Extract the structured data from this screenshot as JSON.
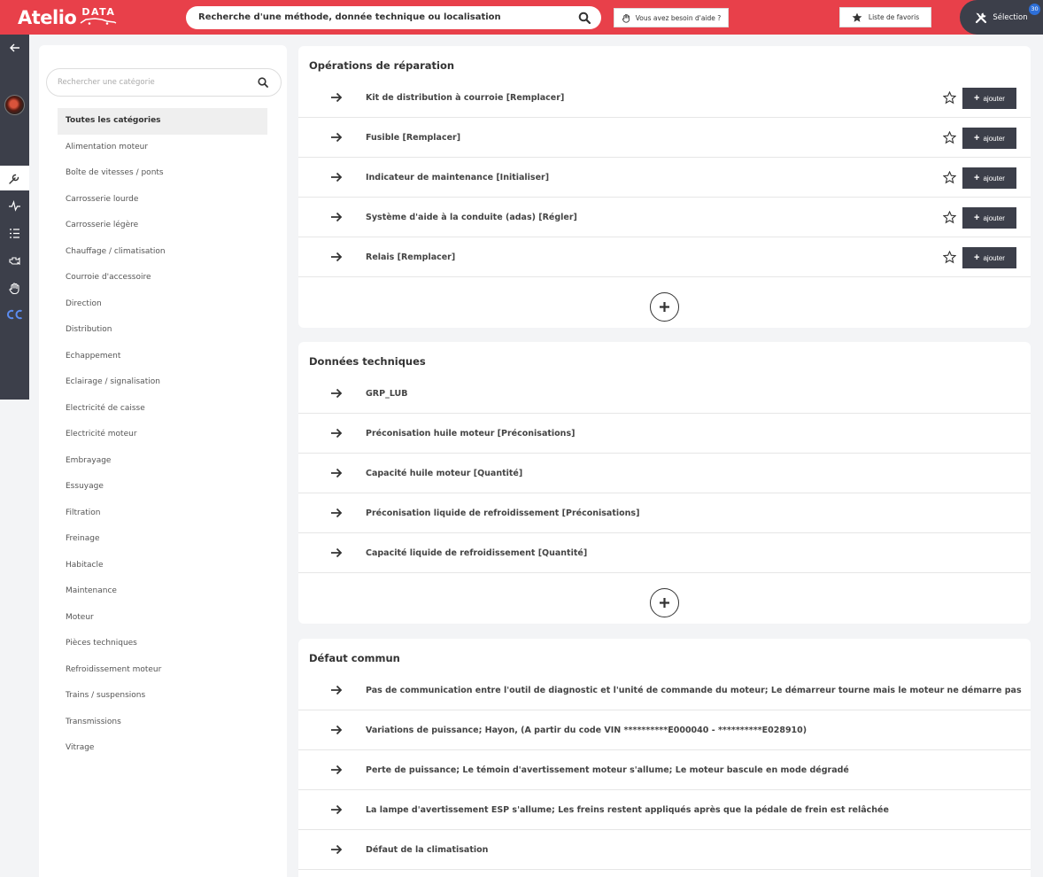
{
  "header": {
    "logo_main": "Atelio",
    "logo_sub": "DATA",
    "search_text": "Recherche d'une méthode, donnée technique ou localisation",
    "help_label": "Vous avez besoin d'aide ?",
    "favorites_label": "Liste de favoris",
    "selection_label": "Sélection",
    "selection_count": "30"
  },
  "sidebar": {
    "icons": [
      "back-arrow-icon",
      "vehicle-avatar",
      "wrench-icon",
      "pulse-icon",
      "list-icon",
      "engine-icon",
      "hand-icon",
      "cc-logo-icon"
    ]
  },
  "categories": {
    "search_placeholder": "Rechercher une catégorie",
    "items": [
      "Toutes les catégories",
      "Alimentation moteur",
      "Boîte de vitesses / ponts",
      "Carrosserie lourde",
      "Carrosserie légère",
      "Chauffage / climatisation",
      "Courroie d'accessoire",
      "Direction",
      "Distribution",
      "Echappement",
      "Eclairage / signalisation",
      "Electricité de caisse",
      "Electricité moteur",
      "Embrayage",
      "Essuyage",
      "Filtration",
      "Freinage",
      "Habitacle",
      "Maintenance",
      "Moteur",
      "Pièces techniques",
      "Refroidissement moteur",
      "Trains / suspensions",
      "Transmissions",
      "Vitrage"
    ],
    "selected": "Toutes les catégories"
  },
  "repair": {
    "title": "Opérations de réparation",
    "add_label": "ajouter",
    "items": [
      "Kit de distribution à courroie [Remplacer]",
      "Fusible [Remplacer]",
      "Indicateur de maintenance [Initialiser]",
      "Système d'aide à la conduite (adas) [Régler]",
      "Relais [Remplacer]"
    ]
  },
  "technical": {
    "title": "Données techniques",
    "items": [
      "GRP_LUB",
      "Préconisation huile moteur [Préconisations]",
      "Capacité huile moteur [Quantité]",
      "Préconisation liquide de refroidissement [Préconisations]",
      "Capacité liquide de refroidissement [Quantité]"
    ]
  },
  "faults": {
    "title": "Défaut commun",
    "items": [
      "Pas de communication entre l'outil de diagnostic et l'unité de commande du moteur; Le démarreur tourne mais le moteur ne démarre pas",
      "Variations de puissance; Hayon, (A partir du code VIN **********E000040 - **********E028910)",
      "Perte de puissance; Le témoin d'avertissement moteur s'allume; Le moteur bascule en mode dégradé",
      "La lampe d'avertissement ESP s'allume; Les freins restent appliqués après que la pédale de frein est relâchée",
      "Défaut de la climatisation"
    ]
  },
  "colors": {
    "brand_red": "#e8404a",
    "dark": "#3c3f4a",
    "badge_blue": "#2d6fd8"
  }
}
